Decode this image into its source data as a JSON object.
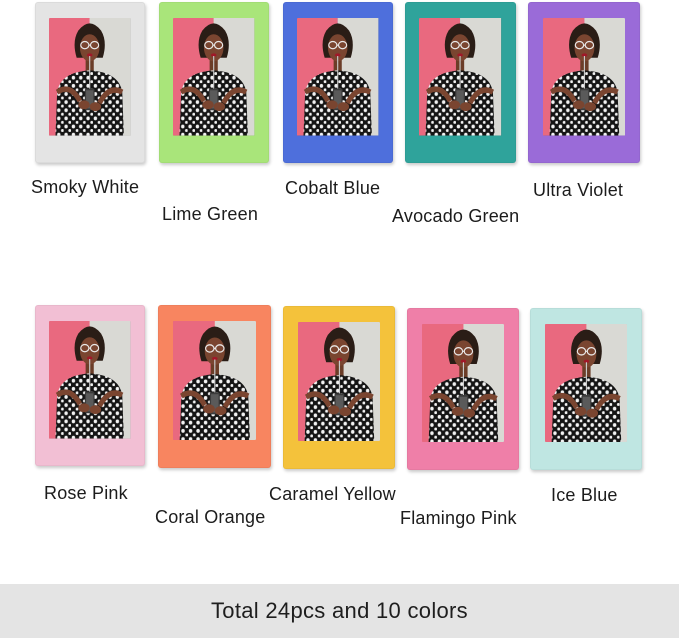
{
  "frames": [
    {
      "name": "Smoky White",
      "color": "#e4e4e4"
    },
    {
      "name": "Lime Green",
      "color": "#a9e57a"
    },
    {
      "name": "Cobalt Blue",
      "color": "#4e6fdc"
    },
    {
      "name": "Avocado Green",
      "color": "#2fa39b"
    },
    {
      "name": "Ultra Violet",
      "color": "#9a6bd8"
    },
    {
      "name": "Rose Pink",
      "color": "#f2bfd4"
    },
    {
      "name": "Coral Orange",
      "color": "#f88560"
    },
    {
      "name": "Caramel Yellow",
      "color": "#f4c23b"
    },
    {
      "name": "Flamingo Pink",
      "color": "#ef7fa8"
    },
    {
      "name": "Ice Blue",
      "color": "#bfe6e2"
    }
  ],
  "photo_icon": "portrait-photo",
  "footer": {
    "text": "Total 24pcs and 10 colors"
  }
}
